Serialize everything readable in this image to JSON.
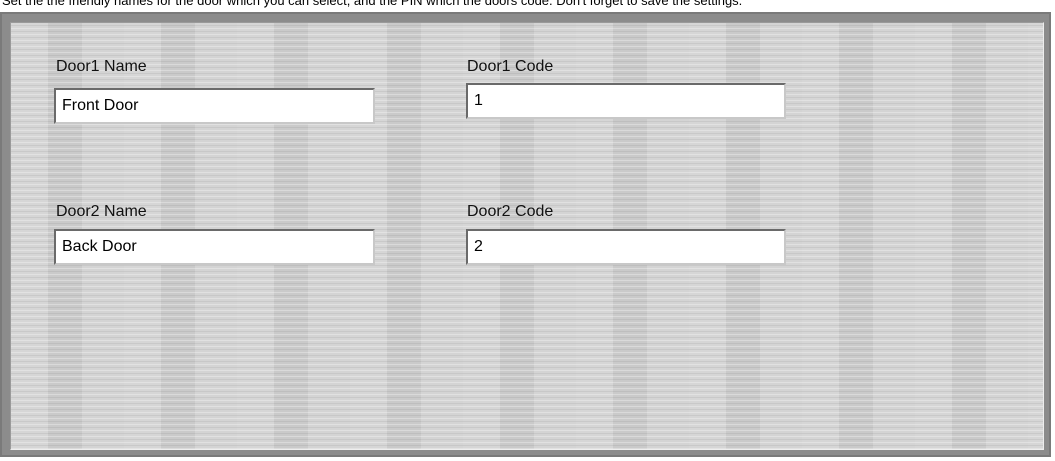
{
  "top_strip": {
    "clipped_text": "Set the the friendly names for the door which you can select, and the PIN which the doors code. Don't forget to save the settings."
  },
  "doors": [
    {
      "name_label": "Door1 Name",
      "name_value": "Front Door",
      "code_label": "Door1 Code",
      "code_value": "1"
    },
    {
      "name_label": "Door2 Name",
      "name_value": "Back Door",
      "code_label": "Door2 Code",
      "code_value": "2"
    }
  ],
  "colors": {
    "panel_background": "#d2d2d2",
    "frame": "#8c8c8c",
    "field_background": "#ffffff"
  }
}
